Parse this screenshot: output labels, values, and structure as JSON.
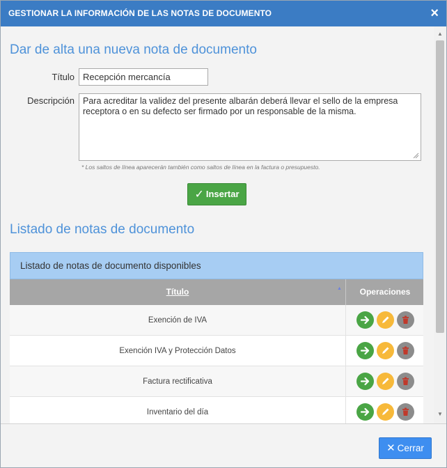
{
  "dialog": {
    "title": "GESTIONAR LA INFORMACIÓN DE LAS NOTAS DE DOCUMENTO",
    "close_icon": "×"
  },
  "form": {
    "heading": "Dar de alta una nueva nota de documento",
    "titulo_label": "Título",
    "titulo_value": "Recepción mercancía",
    "descripcion_label": "Descripción",
    "descripcion_value": "Para acreditar la validez del presente albarán deberá llevar el sello de la empresa receptora o en su defecto ser firmado por un responsable de la misma.",
    "note": "* Los saltos de línea aparecerán también como saltos de línea en la factura o presupuesto.",
    "insert_label": "Insertar"
  },
  "list": {
    "heading": "Listado de notas de documento",
    "caption": "Listado de notas de documento disponibles",
    "columns": {
      "titulo": "Título",
      "operaciones": "Operaciones"
    },
    "rows": [
      {
        "title": "Exención de IVA"
      },
      {
        "title": "Exención IVA y Protección Datos"
      },
      {
        "title": "Factura rectificativa"
      },
      {
        "title": "Inventario del día"
      }
    ]
  },
  "footer": {
    "close_label": "Cerrar"
  },
  "icons": {
    "close": "close-icon",
    "check": "check-icon",
    "sort": "sort-asc-icon",
    "go": "arrow-right-icon",
    "edit": "pencil-icon",
    "delete": "trash-icon"
  },
  "colors": {
    "titlebar": "#3b7cc4",
    "heading": "#4e92d9",
    "insert_button": "#4aa545",
    "caption_bg": "#a7cdf3",
    "header_bg": "#a6a6a6",
    "go": "#4aa545",
    "edit": "#f7b93a",
    "delete": "#8c8c8c",
    "close_button": "#3e8ef0"
  }
}
